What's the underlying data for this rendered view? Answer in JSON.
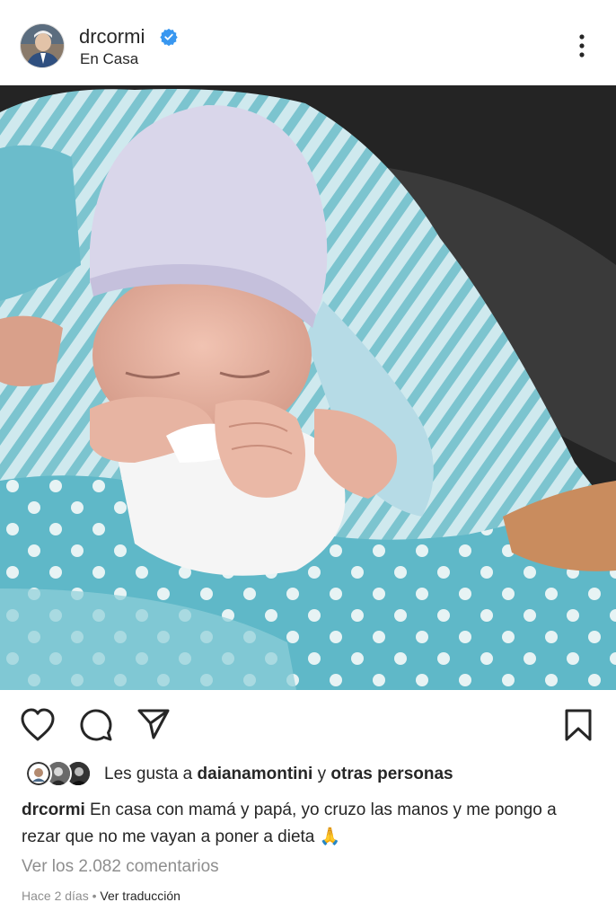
{
  "post": {
    "username": "drcormi",
    "location": "En Casa"
  },
  "likes": {
    "prefix": "Les gusta a ",
    "user": "daianamontini",
    "connector": " y ",
    "others": "otras personas"
  },
  "caption": {
    "username": "drcormi",
    "text": " En casa con mamá y papá, yo cruzo las manos y me pongo a rezar que no me vayan a poner a dieta 🙏"
  },
  "comments_link": "Ver los 2.082 comentarios",
  "meta": {
    "time": "Hace 2 días",
    "separator": " • ",
    "translate": "Ver traducción"
  },
  "icons": {
    "verified": "verified-badge-icon",
    "more": "more-options-icon",
    "like": "heart-icon",
    "comment": "comment-icon",
    "share": "send-icon",
    "save": "bookmark-icon"
  },
  "colors": {
    "verified_blue": "#3897f0",
    "secondary_text": "#8e8e8e",
    "primary_text": "#262626"
  }
}
